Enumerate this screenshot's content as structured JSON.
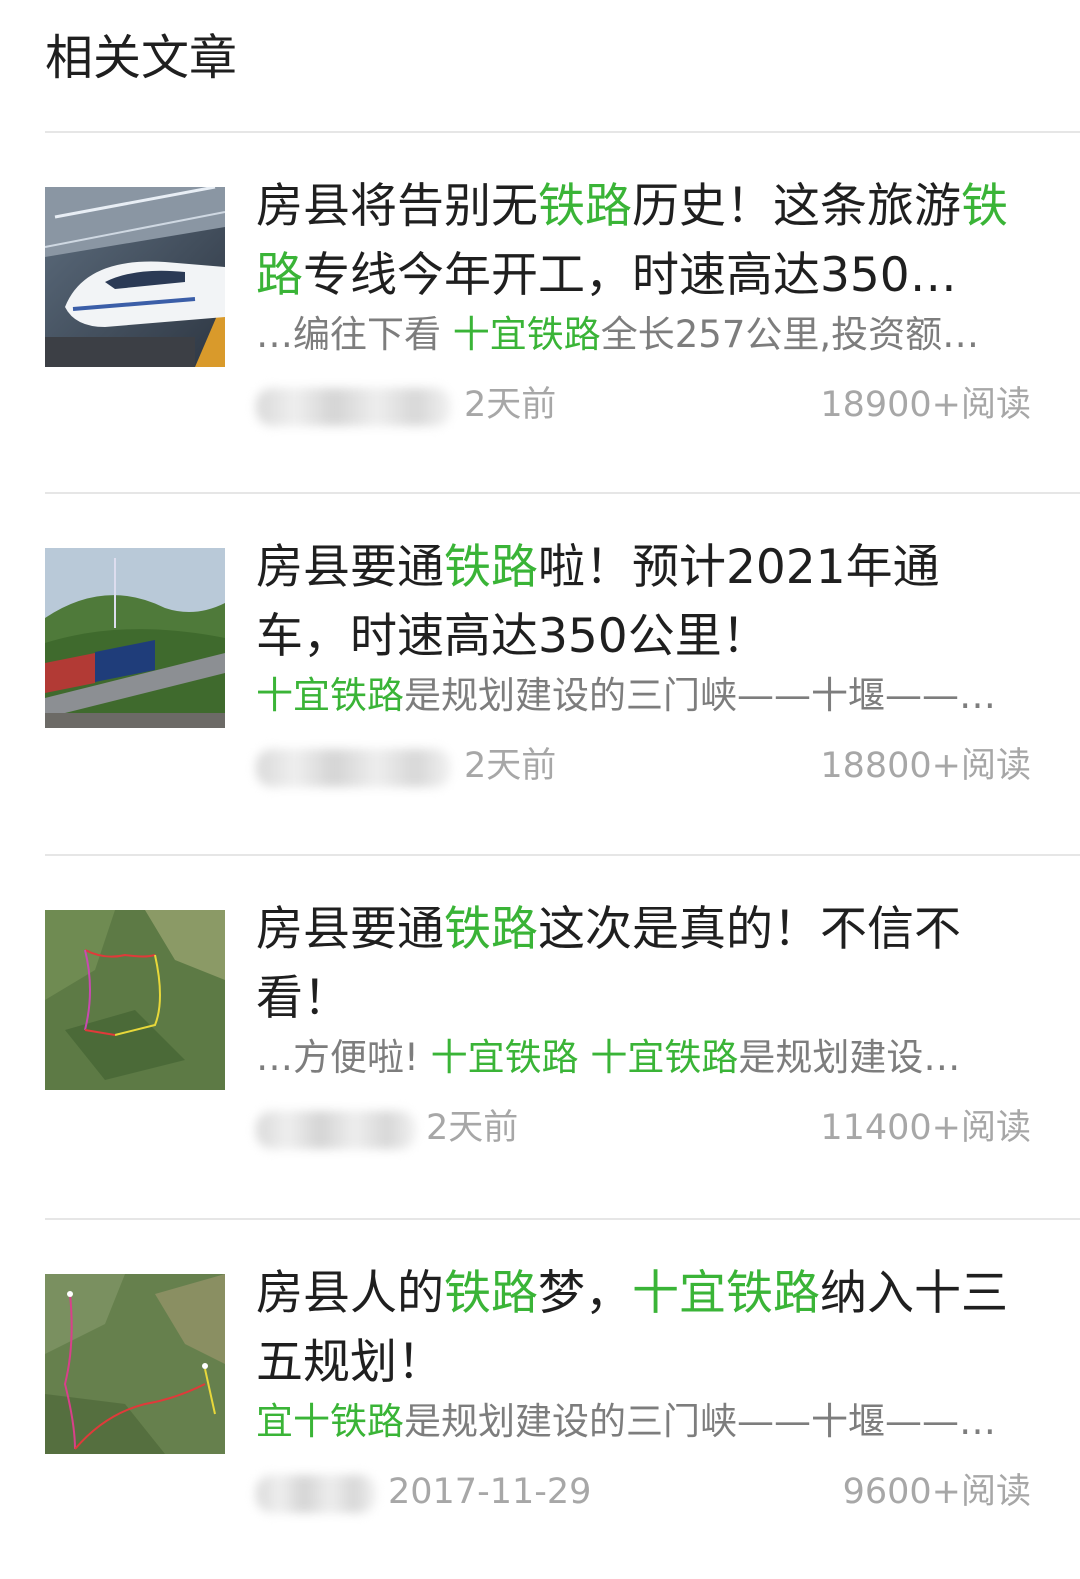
{
  "section_title": "相关文章",
  "articles": [
    {
      "title": [
        {
          "t": "房县将告别无",
          "hl": false
        },
        {
          "t": "铁路",
          "hl": true
        },
        {
          "t": "历史！这条旅游",
          "hl": false
        },
        {
          "t": "铁路",
          "hl": true
        },
        {
          "t": "专线今年开工，时速高达350…",
          "hl": false
        }
      ],
      "summary": [
        {
          "t": "…编往下看 ",
          "hl": false
        },
        {
          "t": "十宜铁路",
          "hl": true
        },
        {
          "t": "全长257公里,投资额…",
          "hl": false
        }
      ],
      "date": "2天前",
      "reads": "18900+阅读",
      "thumbnail": "high-speed-train-photo"
    },
    {
      "title": [
        {
          "t": "房县要通",
          "hl": false
        },
        {
          "t": "铁路",
          "hl": true
        },
        {
          "t": "啦！预计2021年通车，时速高达350公里！",
          "hl": false
        }
      ],
      "summary": [
        {
          "t": "十宜铁路",
          "hl": true
        },
        {
          "t": "是规划建设的三门峡——十堰——…",
          "hl": false
        }
      ],
      "date": "2天前",
      "reads": "18800+阅读",
      "thumbnail": "freight-train-bridge-photo"
    },
    {
      "title": [
        {
          "t": "房县要通",
          "hl": false
        },
        {
          "t": "铁路",
          "hl": true
        },
        {
          "t": "这次是真的！不信不看！",
          "hl": false
        }
      ],
      "summary": [
        {
          "t": "…方便啦! ",
          "hl": false
        },
        {
          "t": "十宜铁路 十宜铁路",
          "hl": true
        },
        {
          "t": "是规划建设…",
          "hl": false
        }
      ],
      "date": "2天前",
      "reads": "11400+阅读",
      "thumbnail": "satellite-route-map"
    },
    {
      "title": [
        {
          "t": "房县人的",
          "hl": false
        },
        {
          "t": "铁路",
          "hl": true
        },
        {
          "t": "梦，",
          "hl": false
        },
        {
          "t": "十宜铁路",
          "hl": true
        },
        {
          "t": "纳入十三五规划！",
          "hl": false
        }
      ],
      "summary": [
        {
          "t": "宜十铁路",
          "hl": true
        },
        {
          "t": "是规划建设的三门峡——十堰——…",
          "hl": false
        }
      ],
      "date": "2017-11-29",
      "reads": "9600+阅读",
      "thumbnail": "satellite-route-map-labeled"
    }
  ],
  "colors": {
    "highlight": "#3ab437",
    "title_text": "#1f1f1f",
    "summary_text": "#7d7d7d",
    "meta_text": "#a7a7a7",
    "divider": "#e6e6e6"
  }
}
